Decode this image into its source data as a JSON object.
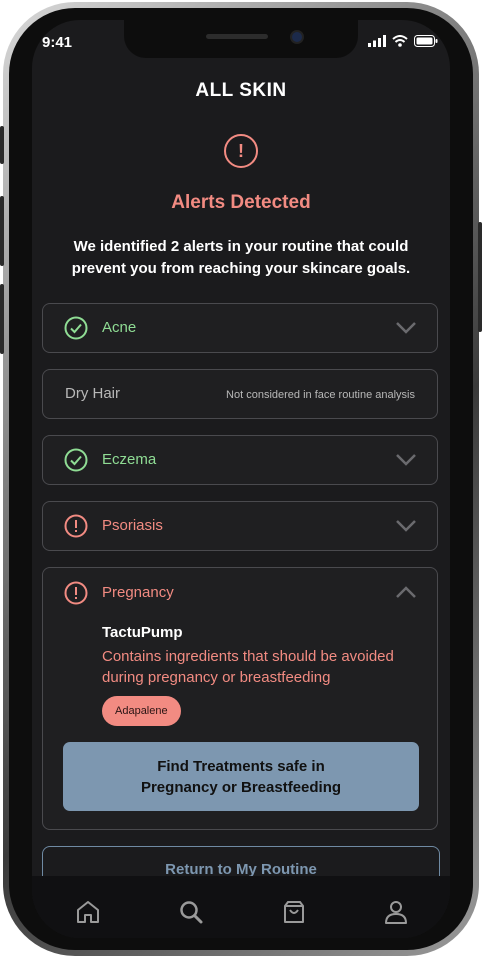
{
  "status_bar": {
    "time": "9:41"
  },
  "brand": "ALL SKIN",
  "alert": {
    "title": "Alerts Detected",
    "description": "We identified 2 alerts in your routine that could prevent you from reaching your skincare goals."
  },
  "conditions": [
    {
      "label": "Acne",
      "status": "ok"
    },
    {
      "label": "Dry Hair",
      "note": "Not considered in face routine analysis"
    },
    {
      "label": "Eczema",
      "status": "ok"
    },
    {
      "label": "Psoriasis",
      "status": "alert"
    },
    {
      "label": "Pregnancy",
      "status": "alert",
      "expanded": true,
      "product": "TactuPump",
      "warning": "Contains ingredients that should be avoided during pregnancy or breastfeeding",
      "ingredient": "Adapalene",
      "cta_line1": "Find Treatments safe in",
      "cta_line2": "Pregnancy or Breastfeeding"
    }
  ],
  "return_button": "Return to My Routine",
  "tabs": [
    {
      "icon": "home-icon"
    },
    {
      "icon": "search-icon"
    },
    {
      "icon": "shopping-bag-icon"
    },
    {
      "icon": "profile-icon"
    }
  ],
  "colors": {
    "ok": "#8fdc94",
    "alert": "#f28b82",
    "cta": "#7d97b0",
    "background": "#1b1b1d"
  }
}
